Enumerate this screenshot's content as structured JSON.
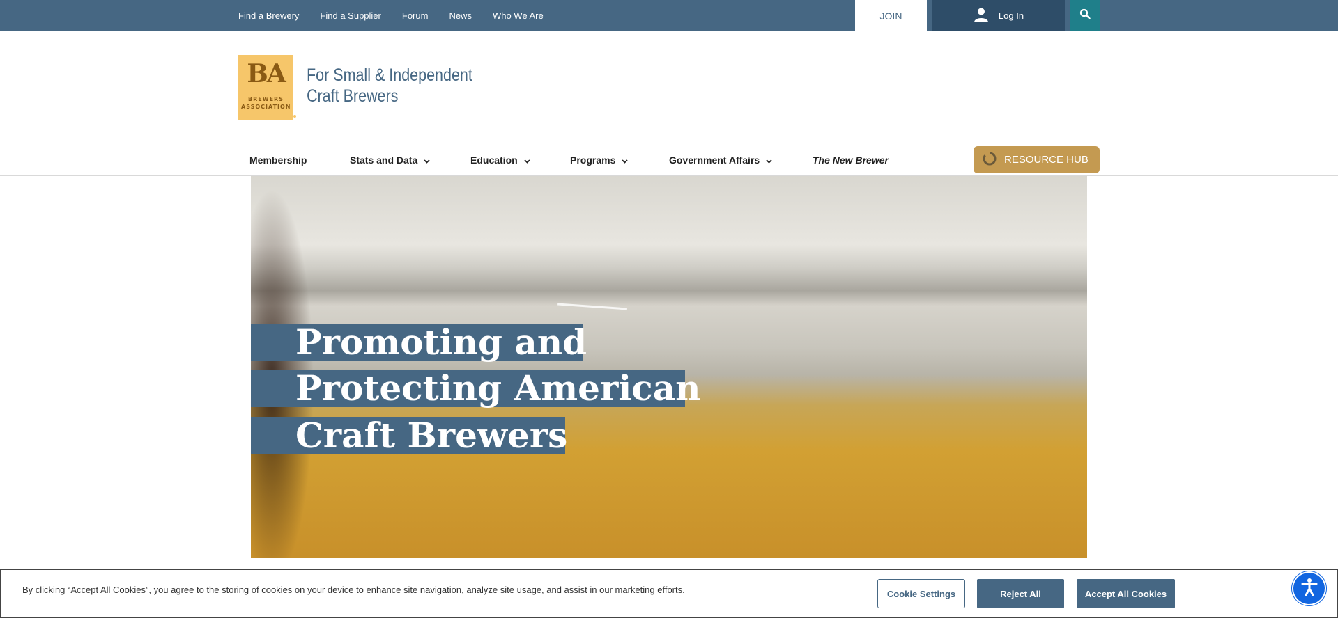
{
  "topbar": {
    "links": [
      "Find a Brewery",
      "Find a Supplier",
      "Forum",
      "News",
      "Who We Are"
    ],
    "join_label": "JOIN",
    "login_label": "Log In"
  },
  "header": {
    "logo_ba": "BA",
    "logo_sub_line1": "BREWERS",
    "logo_sub_line2": "ASSOCIATION",
    "tagline_line1": "For Small & Independent",
    "tagline_line2": "Craft Brewers"
  },
  "nav": {
    "items": [
      {
        "label": "Membership"
      },
      {
        "label": "Stats and Data"
      },
      {
        "label": "Education"
      },
      {
        "label": "Programs"
      },
      {
        "label": "Government Affairs"
      },
      {
        "label": "The New Brewer"
      }
    ],
    "resource_hub": "RESOURCE HUB"
  },
  "hero": {
    "line1": "Promoting and",
    "line2": "Protecting American",
    "line3": "Craft Brewers"
  },
  "cookie": {
    "text": "By clicking “Accept All Cookies”, you agree to the storing of cookies on your device to enhance site navigation, analyze site usage, and assist in our marketing efforts.",
    "settings_label": "Cookie Settings",
    "reject_label": "Reject All",
    "accept_label": "Accept All Cookies"
  },
  "colors": {
    "brand_blue": "#466783",
    "brand_gold": "#c49a51",
    "search_teal": "#1f7f8a",
    "a11y_blue": "#1266e0"
  },
  "icons": [
    "user-icon",
    "search-icon",
    "chevron-down-icon",
    "resource-hub-icon",
    "accessibility-icon"
  ]
}
